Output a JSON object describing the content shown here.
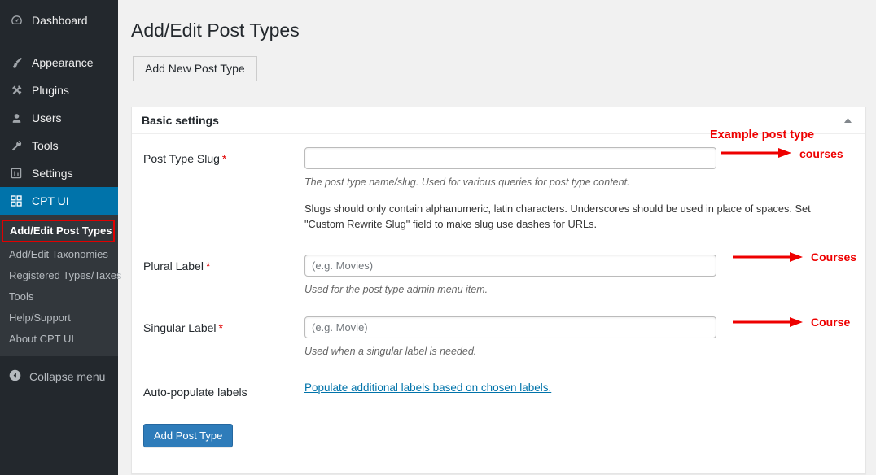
{
  "sidebar": {
    "top_items": [
      {
        "label": "Dashboard",
        "icon": "dashboard-gauge-icon"
      }
    ],
    "group_items": [
      {
        "label": "Appearance",
        "icon": "paintbrush-icon"
      },
      {
        "label": "Plugins",
        "icon": "plug-icon"
      },
      {
        "label": "Users",
        "icon": "user-icon"
      },
      {
        "label": "Tools",
        "icon": "wrench-icon"
      },
      {
        "label": "Settings",
        "icon": "sliders-icon"
      }
    ],
    "current_item": {
      "label": "CPT UI",
      "icon": "cpt-ui-grid-icon"
    },
    "submenu": [
      {
        "label": "Add/Edit Post Types",
        "active": true
      },
      {
        "label": "Add/Edit Taxonomies",
        "active": false
      },
      {
        "label": "Registered Types/Taxes",
        "active": false
      },
      {
        "label": "Tools",
        "active": false
      },
      {
        "label": "Help/Support",
        "active": false
      },
      {
        "label": "About CPT UI",
        "active": false
      }
    ],
    "collapse": {
      "label": "Collapse menu",
      "icon": "collapse-left-arrow-icon"
    }
  },
  "page": {
    "title": "Add/Edit Post Types",
    "tab_label": "Add New Post Type"
  },
  "panel": {
    "title": "Basic settings",
    "toggle_icon": "triangle-up-icon"
  },
  "fields": {
    "slug": {
      "label": "Post Type Slug",
      "required_mark": "*",
      "value": "",
      "placeholder": "",
      "help": "The post type name/slug. Used for various queries for post type content.",
      "note": "Slugs should only contain alphanumeric, latin characters. Underscores should be used in place of spaces. Set \"Custom Rewrite Slug\" field to make slug use dashes for URLs."
    },
    "plural": {
      "label": "Plural Label",
      "required_mark": "*",
      "value": "",
      "placeholder": "(e.g. Movies)",
      "help": "Used for the post type admin menu item."
    },
    "singular": {
      "label": "Singular Label",
      "required_mark": "*",
      "value": "",
      "placeholder": "(e.g. Movie)",
      "help": "Used when a singular label is needed."
    },
    "autopopulate": {
      "label": "Auto-populate labels",
      "link_text": "Populate additional labels based on chosen labels."
    }
  },
  "submit": {
    "label": "Add Post Type"
  },
  "annotations": {
    "heading": "Example post type",
    "slug_value": "courses",
    "plural_value": "Courses",
    "singular_value": "Course",
    "color": "#ee0000"
  },
  "colors": {
    "sidebar_bg": "#23282d",
    "submenu_bg": "#32373c",
    "accent_blue": "#0073aa",
    "button_blue": "#2e7cba",
    "page_bg": "#f1f1f1",
    "highlight_red": "#e00000"
  }
}
